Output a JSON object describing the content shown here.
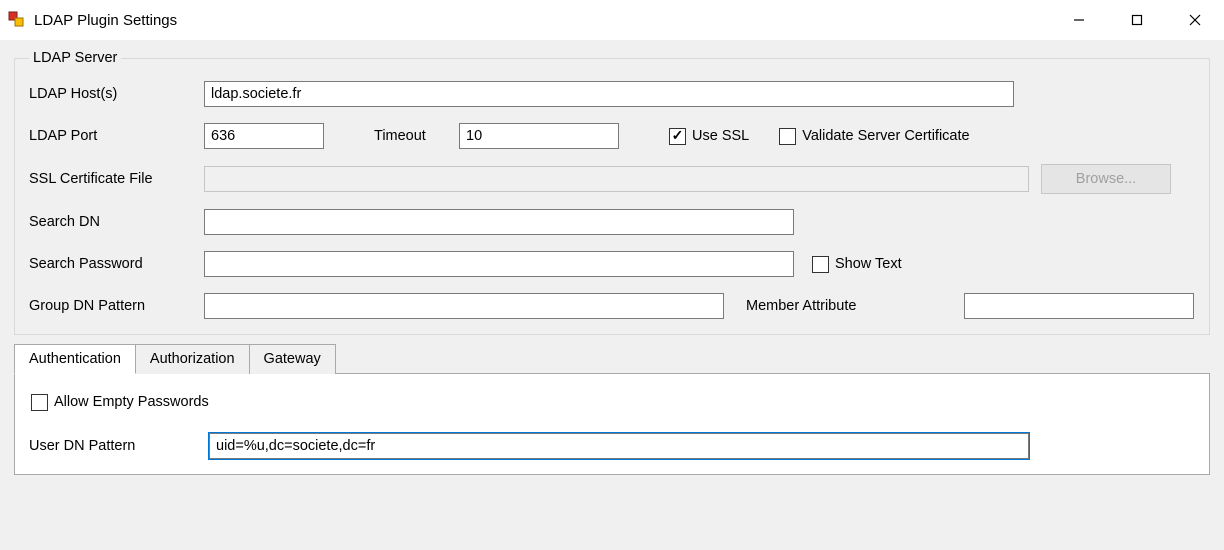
{
  "window": {
    "title": "LDAP Plugin Settings"
  },
  "group": {
    "legend": "LDAP Server",
    "ldap_host_label": "LDAP Host(s)",
    "ldap_host_value": "ldap.societe.fr",
    "ldap_port_label": "LDAP Port",
    "ldap_port_value": "636",
    "timeout_label": "Timeout",
    "timeout_value": "10",
    "use_ssl_label": "Use SSL",
    "use_ssl_checked": true,
    "validate_cert_label": "Validate Server Certificate",
    "validate_cert_checked": false,
    "ssl_cert_label": "SSL Certificate File",
    "ssl_cert_value": "",
    "browse_label": "Browse...",
    "search_dn_label": "Search DN",
    "search_dn_value": "",
    "search_pw_label": "Search Password",
    "search_pw_value": "",
    "show_text_label": "Show Text",
    "show_text_checked": false,
    "group_dn_label": "Group DN Pattern",
    "group_dn_value": "",
    "member_attr_label": "Member Attribute",
    "member_attr_value": ""
  },
  "tabs": {
    "authentication": "Authentication",
    "authorization": "Authorization",
    "gateway": "Gateway"
  },
  "auth_tab": {
    "allow_empty_label": "Allow Empty Passwords",
    "allow_empty_checked": false,
    "user_dn_label": "User DN Pattern",
    "user_dn_value": "uid=%u,dc=societe,dc=fr"
  }
}
